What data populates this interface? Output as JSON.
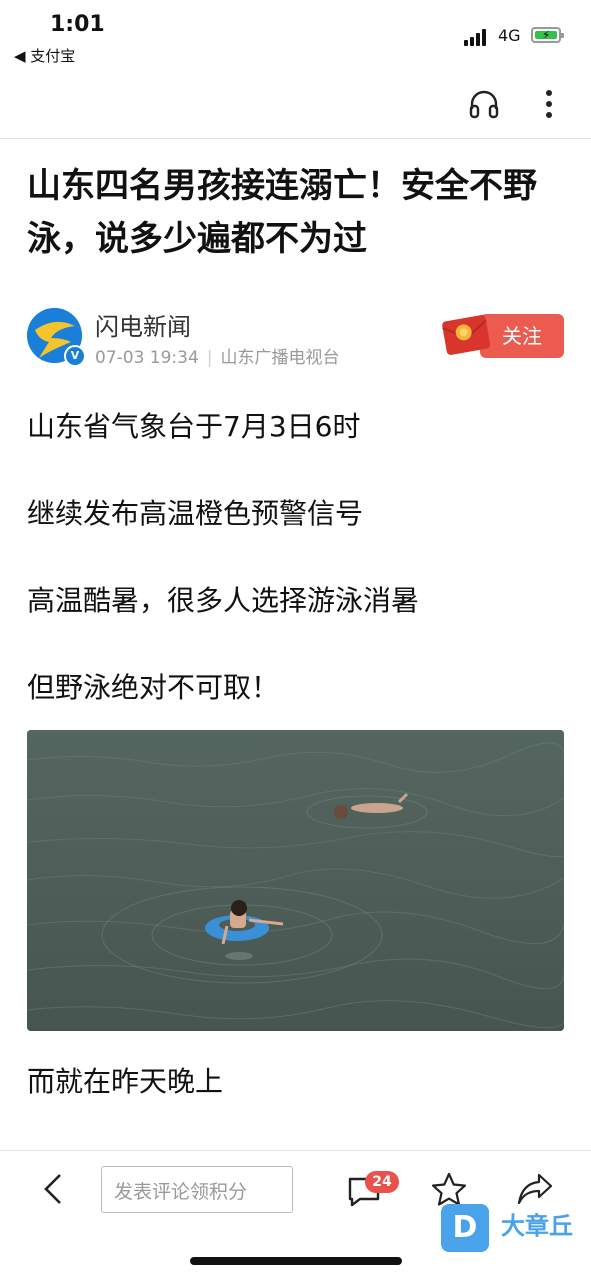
{
  "status_bar": {
    "time": "1:01",
    "back_app": "◀ 支付宝",
    "network": "4G"
  },
  "article": {
    "title": "山东四名男孩接连溺亡！安全不野泳，说多少遍都不为过",
    "author": {
      "name": "闪电新闻",
      "date": "07-03 19:34",
      "source": "山东广播电视台",
      "follow_label": "关注"
    },
    "paragraphs": [
      "山东省气象台于7月3日6时",
      "继续发布高温橙色预警信号",
      "高温酷暑，很多人选择游泳消暑",
      "但野泳绝对不可取！",
      "而就在昨天晚上"
    ]
  },
  "bottom_bar": {
    "comment_placeholder": "发表评论领积分",
    "comment_count": "24"
  },
  "watermark": {
    "logo_letter": "D",
    "text": "大章丘"
  },
  "colors": {
    "follow": "#ec5b4f",
    "badge": "#e9514a",
    "battery": "#35c04b",
    "brand_blue": "#1a7fd8",
    "watermark_blue": "#4aa3ea"
  },
  "icons": [
    "headphones-icon",
    "more-vertical-icon",
    "back-icon",
    "comment-icon",
    "star-icon",
    "share-icon"
  ]
}
